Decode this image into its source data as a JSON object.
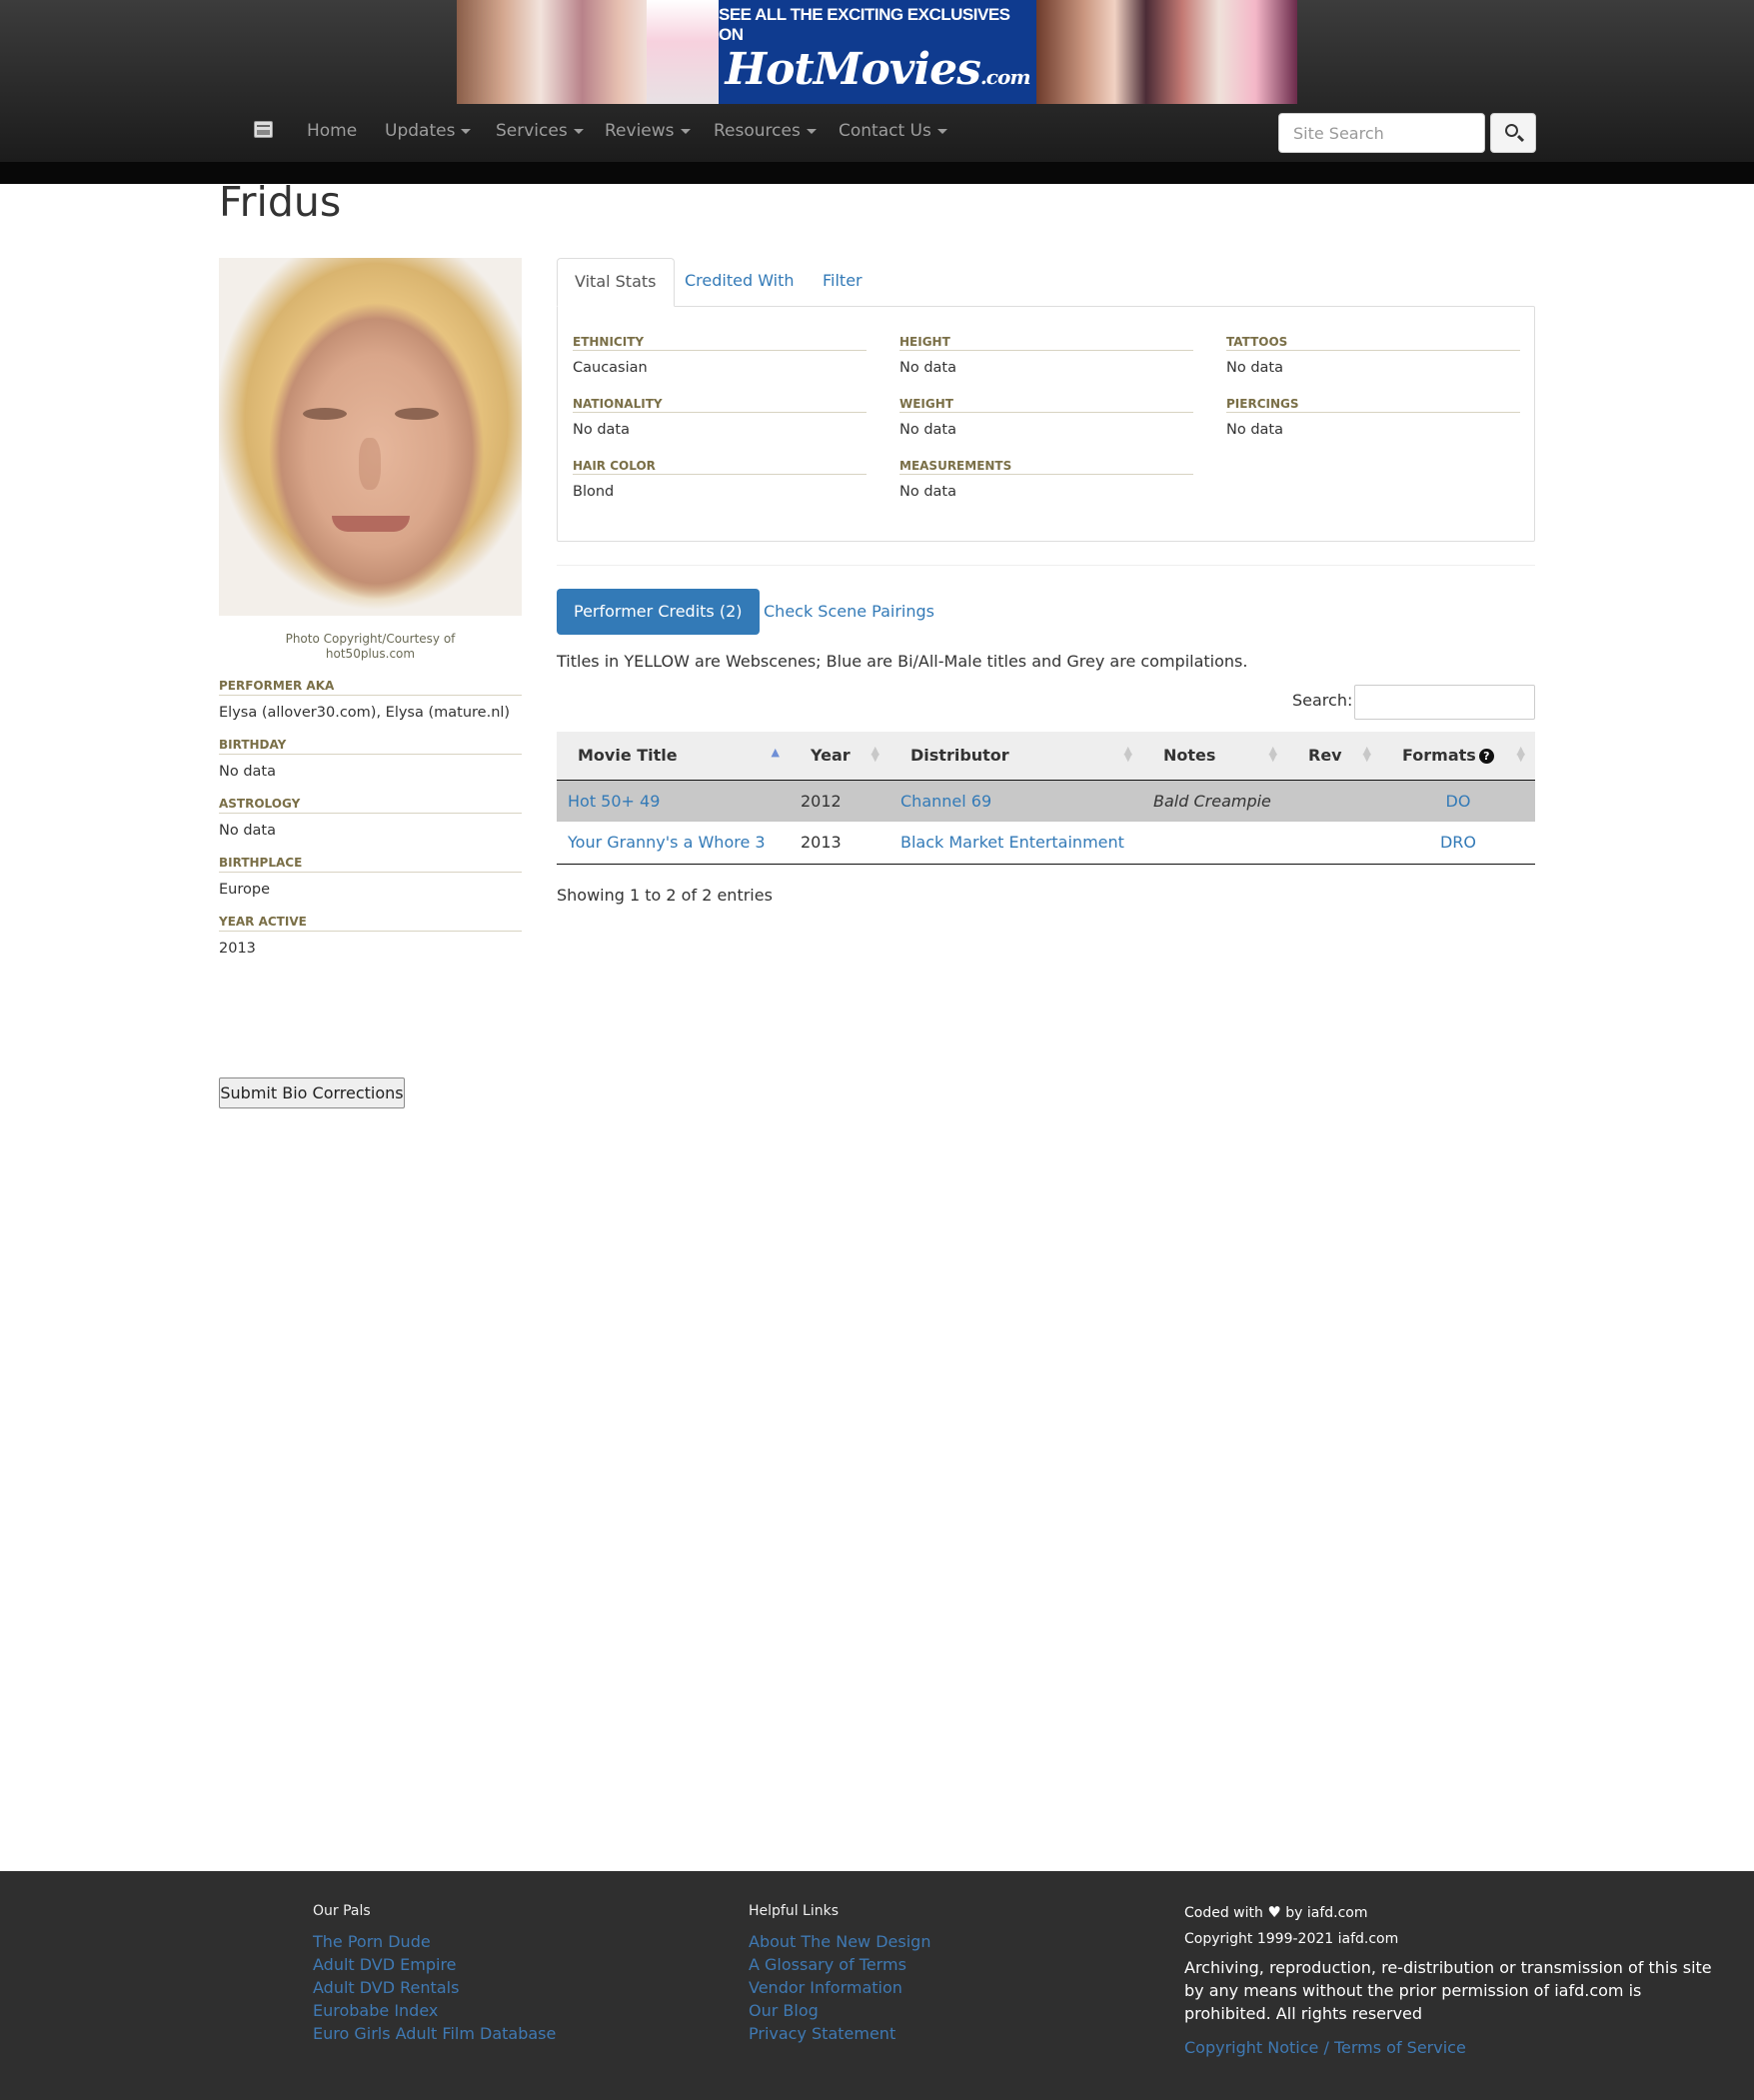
{
  "banner": {
    "tagline": "SEE ALL THE EXCITING EXCLUSIVES ON",
    "brand": "HotMovies",
    "brand_suffix": ".com"
  },
  "nav": {
    "items": [
      {
        "label": "Home",
        "dropdown": false
      },
      {
        "label": "Updates",
        "dropdown": true
      },
      {
        "label": "Services",
        "dropdown": true
      },
      {
        "label": "Reviews",
        "dropdown": true
      },
      {
        "label": "Resources",
        "dropdown": true
      },
      {
        "label": "Contact Us",
        "dropdown": true
      }
    ],
    "search_placeholder": "Site Search",
    "search_icon": "search-icon"
  },
  "performer": {
    "name": "Fridus",
    "photo_credit_line1": "Photo Copyright/Courtesy of",
    "photo_credit_line2": "hot50plus.com",
    "bio": [
      {
        "label": "PERFORMER AKA",
        "value": "Elysa (allover30.com), Elysa (mature.nl)"
      },
      {
        "label": "BIRTHDAY",
        "value": "No data"
      },
      {
        "label": "ASTROLOGY",
        "value": "No data"
      },
      {
        "label": "BIRTHPLACE",
        "value": "Europe"
      },
      {
        "label": "YEAR ACTIVE",
        "value": "2013"
      }
    ],
    "submit_label": "Submit Bio Corrections"
  },
  "tabs": {
    "vital": "Vital Stats",
    "credited": "Credited With",
    "filter": "Filter"
  },
  "vital_stats": {
    "ethnicity": {
      "label": "ETHNICITY",
      "value": "Caucasian"
    },
    "nationality": {
      "label": "NATIONALITY",
      "value": "No data"
    },
    "hair": {
      "label": "HAIR COLOR",
      "value": "Blond"
    },
    "height": {
      "label": "HEIGHT",
      "value": "No data"
    },
    "weight": {
      "label": "WEIGHT",
      "value": "No data"
    },
    "measurements": {
      "label": "MEASUREMENTS",
      "value": "No data"
    },
    "tattoos": {
      "label": "TATTOOS",
      "value": "No data"
    },
    "piercings": {
      "label": "PIERCINGS",
      "value": "No data"
    }
  },
  "credits": {
    "tab_active": "Performer Credits (2)",
    "tab_pairings": "Check Scene Pairings",
    "note": "Titles in YELLOW are Webscenes; Blue are Bi/All-Male titles and Grey are compilations.",
    "search_label": "Search:",
    "columns": {
      "title": "Movie Title",
      "year": "Year",
      "distributor": "Distributor",
      "notes": "Notes",
      "rev": "Rev",
      "formats": "Formats",
      "formats_help": "?"
    },
    "rows": [
      {
        "title": "Hot 50+ 49",
        "year": "2012",
        "distributor": "Channel 69",
        "notes": "Bald Creampie",
        "rev": "",
        "formats": "DO"
      },
      {
        "title": "Your Granny's a Whore 3",
        "year": "2013",
        "distributor": "Black Market Entertainment",
        "notes": "",
        "rev": "",
        "formats": "DRO"
      }
    ],
    "showing": "Showing 1 to 2 of 2 entries"
  },
  "footer": {
    "pals_title": "Our Pals",
    "pals": [
      "The Porn Dude",
      "Adult DVD Empire",
      "Adult DVD Rentals",
      "Eurobabe Index",
      "Euro Girls Adult Film Database"
    ],
    "links_title": "Helpful Links",
    "links": [
      "About The New Design",
      "A Glossary of Terms",
      "Vendor Information",
      "Our Blog",
      "Privacy Statement"
    ],
    "coded_prefix": "Coded with",
    "coded_suffix": "by iafd.com",
    "copyright": "Copyright 1999-2021 iafd.com",
    "rights": "Archiving, reproduction, re-distribution or transmission of this site by any means without the prior permission of iafd.com is prohibited. All rights reserved",
    "terms": "Copyright Notice / Terms of Service"
  }
}
